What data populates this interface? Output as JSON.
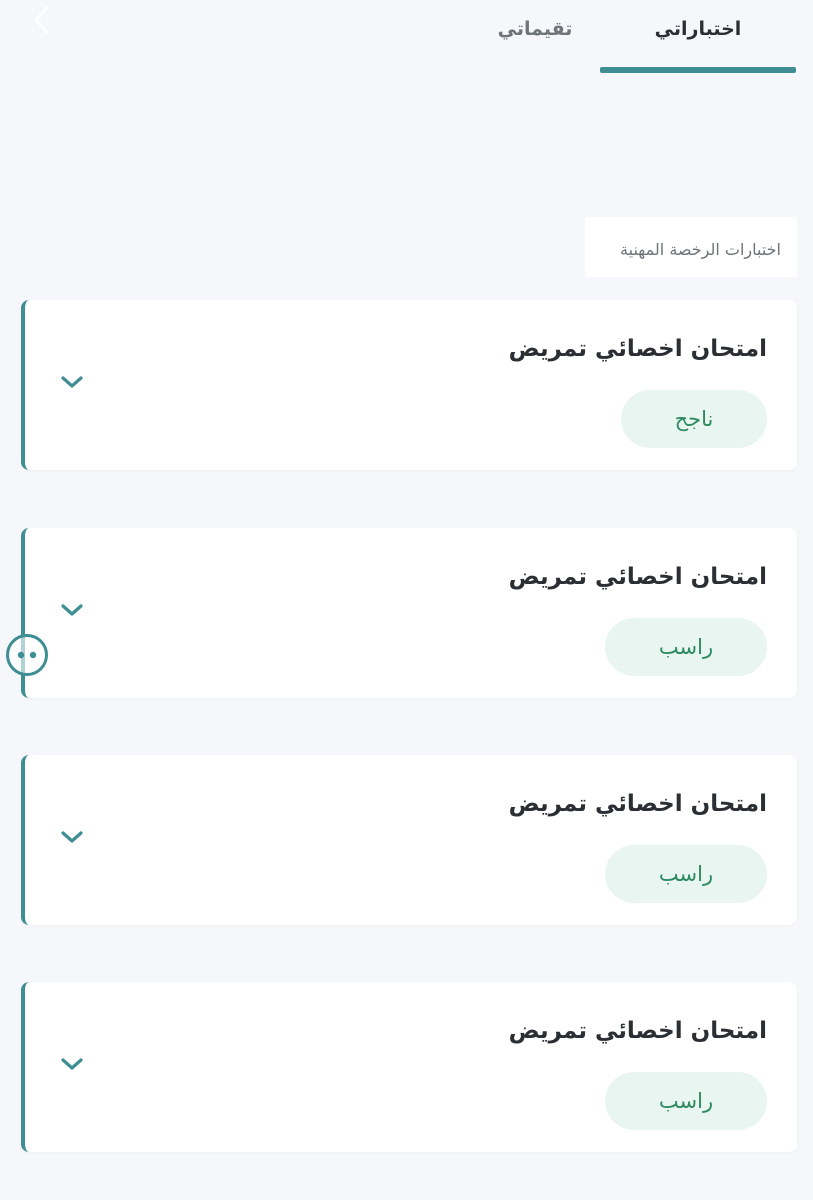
{
  "header": {
    "tabs": [
      {
        "label": "اختباراتي",
        "active": true
      },
      {
        "label": "تقيماتي",
        "active": false
      }
    ]
  },
  "section": {
    "label": "اختبارات الرخصة المهنية"
  },
  "exams": [
    {
      "title": "امتحان اخصائي تمريض",
      "status": "ناجح"
    },
    {
      "title": "امتحان اخصائي تمريض",
      "status": "راسب"
    },
    {
      "title": "امتحان اخصائي تمريض",
      "status": "راسب"
    },
    {
      "title": "امتحان اخصائي تمريض",
      "status": "راسب"
    }
  ],
  "colors": {
    "accent": "#3e8e93",
    "badge_bg": "#e9f5f0",
    "badge_text": "#2d8a63",
    "background": "#f5f7fa"
  },
  "icons": {
    "back": "chevron-left-icon",
    "expand": "chevron-down-icon",
    "floating": "accessibility-widget-icon"
  }
}
